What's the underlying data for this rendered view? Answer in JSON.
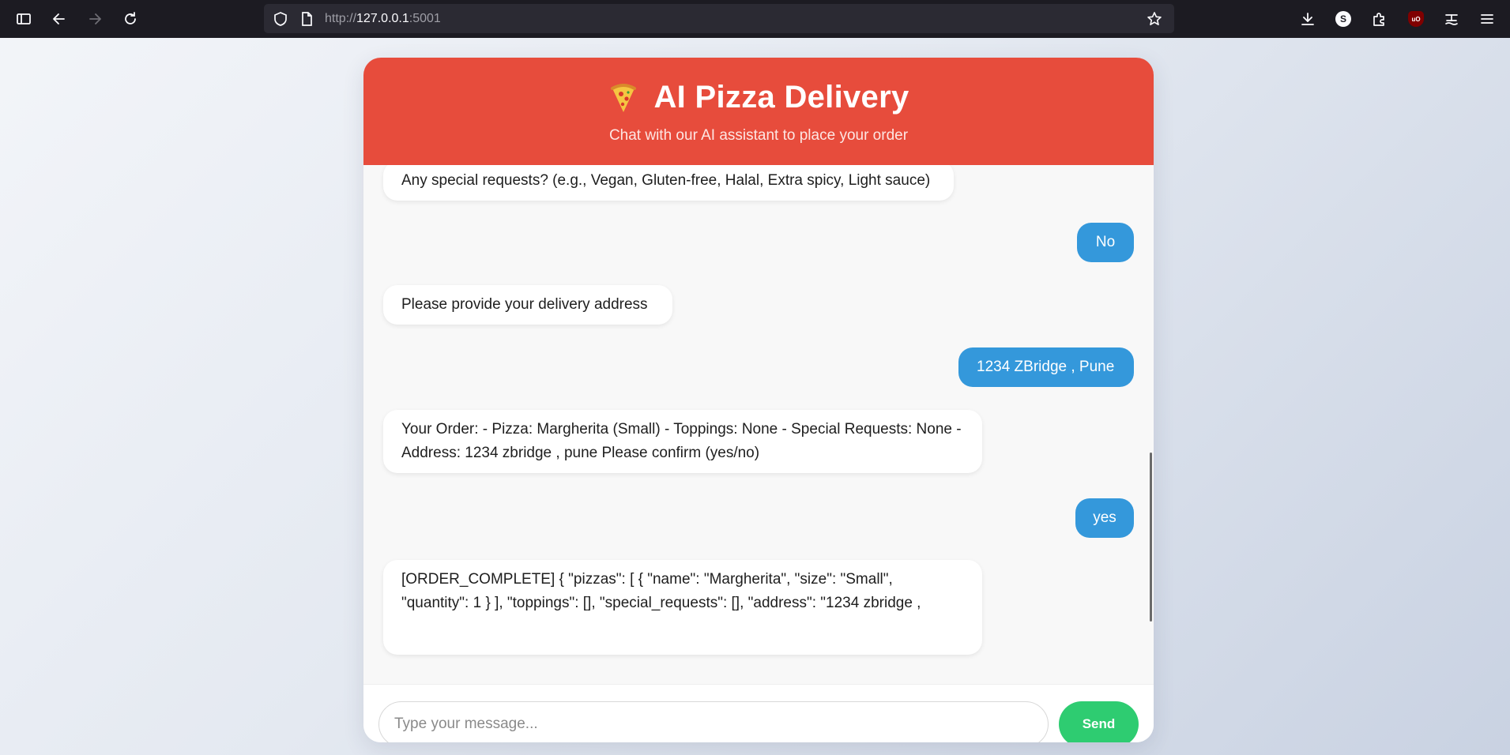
{
  "browser": {
    "url_scheme": "http://",
    "url_host": "127.0.0.1",
    "url_port": ":5001",
    "account_badge": "S",
    "ublock_badge": "uO",
    "icons": [
      "sidebar-icon",
      "back-icon",
      "forward-icon",
      "reload-icon",
      "shield-icon",
      "page-icon",
      "bookmark-star-icon",
      "download-icon",
      "account-icon",
      "extensions-icon",
      "ublock-icon",
      "translate-icon",
      "menu-icon"
    ]
  },
  "chat": {
    "title": "AI Pizza Delivery",
    "subtitle": "Chat with our AI assistant to place your order",
    "header_icon": "pizza-icon",
    "colors": {
      "header": "#e74c3c",
      "user_bubble": "#3498db",
      "send_button": "#2ecc71"
    },
    "messages": [
      {
        "role": "bot",
        "text": "Any special requests? (e.g., Vegan, Gluten-free, Halal, Extra spicy, Light sauce)"
      },
      {
        "role": "user",
        "text": "No"
      },
      {
        "role": "bot",
        "text": "Please provide your delivery address"
      },
      {
        "role": "user",
        "text": "1234 ZBridge , Pune"
      },
      {
        "role": "bot",
        "text": "Your Order: - Pizza: Margherita (Small) - Toppings: None - Special Requests: None - Address: 1234 zbridge , pune Please confirm (yes/no)"
      },
      {
        "role": "user",
        "text": "yes"
      },
      {
        "role": "bot",
        "text": "[ORDER_COMPLETE] { \"pizzas\": [ { \"name\": \"Margherita\", \"size\": \"Small\", \"quantity\": 1 } ], \"toppings\": [], \"special_requests\": [], \"address\": \"1234 zbridge ,"
      }
    ],
    "input": {
      "placeholder": "Type your message...",
      "value": ""
    },
    "send_label": "Send"
  }
}
